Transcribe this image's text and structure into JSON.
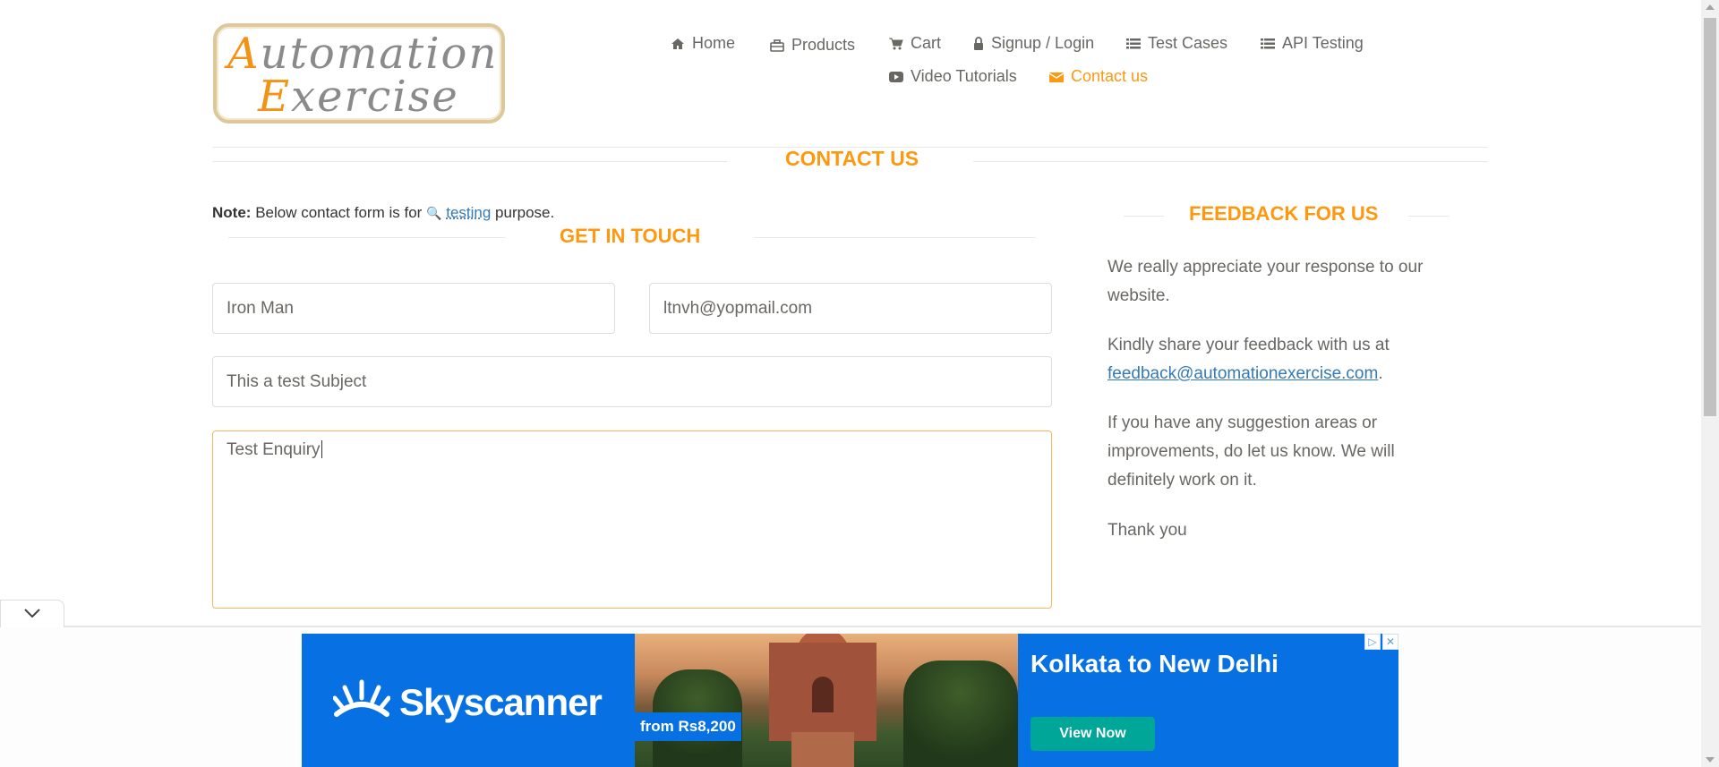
{
  "logo": {
    "line1_cap": "A",
    "line1_rest": "utomation",
    "line2_cap": "E",
    "line2_rest": "xercise"
  },
  "nav": {
    "items": [
      {
        "label": "Home",
        "icon": "home-icon"
      },
      {
        "label": "Products",
        "icon": "briefcase-icon"
      },
      {
        "label": "Cart",
        "icon": "cart-icon"
      },
      {
        "label": "Signup / Login",
        "icon": "lock-icon"
      },
      {
        "label": "Test Cases",
        "icon": "list-icon"
      },
      {
        "label": "API Testing",
        "icon": "list-icon"
      },
      {
        "label": "Video Tutorials",
        "icon": "youtube-icon"
      },
      {
        "label": "Contact us",
        "icon": "envelope-icon",
        "active": true
      }
    ]
  },
  "page": {
    "title": "CONTACT US"
  },
  "note": {
    "bold": "Note:",
    "text_before": "Below contact form is for",
    "link": "testing",
    "text_after": "purpose."
  },
  "form": {
    "heading": "GET IN TOUCH",
    "name_value": "Iron Man",
    "email_value": "ltnvh@yopmail.com",
    "subject_value": "This a test Subject",
    "message_value": "Test Enquiry"
  },
  "feedback": {
    "heading": "FEEDBACK FOR US",
    "p1": "We really appreciate your response to our website.",
    "p2_text": "Kindly share your feedback with us at",
    "p2_link": "feedback@automationexercise.com",
    "p2_end": ".",
    "p3": "If you have any suggestion areas or improvements, do let us know. We will definitely work on it.",
    "p4": "Thank you"
  },
  "ad": {
    "brand": "Skyscanner",
    "price": "from Rs8,200",
    "route": "Kolkata to New Delhi",
    "button": "View Now"
  },
  "colors": {
    "accent": "#fe980f",
    "link": "#337ab7",
    "ad_blue": "#0770e3",
    "ad_button": "#00a698"
  }
}
